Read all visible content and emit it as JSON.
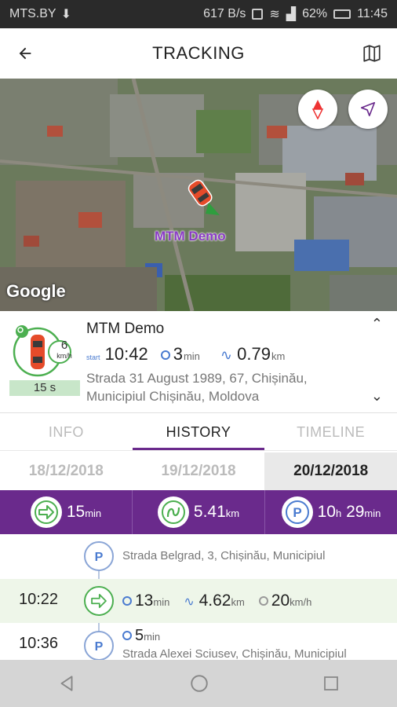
{
  "status": {
    "carrier": "MTS.BY",
    "speed": "617 B/s",
    "battery": "62%",
    "time": "11:45"
  },
  "appbar": {
    "title": "TRACKING"
  },
  "map": {
    "vehicle_label": "MTM Demo",
    "provider": "Google"
  },
  "vehicle": {
    "name": "MTM Demo",
    "speed": "6",
    "speed_unit": "km/h",
    "timer": "15 s",
    "start_tag": "start",
    "start_time": "10:42",
    "duration": "3",
    "duration_unit": "min",
    "distance": "0.79",
    "distance_unit": "km",
    "address_line1": "Strada 31 August 1989, 67, Chișinău,",
    "address_line2": "Municipiul Chișinău, Moldova"
  },
  "tabs": [
    {
      "label": "INFO"
    },
    {
      "label": "HISTORY"
    },
    {
      "label": "TIMELINE"
    }
  ],
  "dates": [
    "18/12/2018",
    "19/12/2018",
    "20/12/2018"
  ],
  "summary": {
    "drive_time": "15",
    "drive_unit": "min",
    "distance": "5.41",
    "distance_unit": "km",
    "park_h": "10",
    "park_h_unit": "h",
    "park_m": "29",
    "park_m_unit": "min"
  },
  "timeline": {
    "row1": {
      "address": "Strada Belgrad, 3, Chișinău, Municipiul"
    },
    "row2": {
      "time": "10:22",
      "duration": "13",
      "duration_unit": "min",
      "distance": "4.62",
      "distance_unit": "km",
      "speed": "20",
      "speed_unit": "km/h"
    },
    "row3": {
      "time": "10:36",
      "duration": "5",
      "duration_unit": "min",
      "address": "Strada Alexei Sciusev, Chișinău, Municipiul"
    }
  },
  "colors": {
    "purple": "#6a2a8c",
    "green": "#4caf50",
    "map_label": "#8a3bc5"
  },
  "icons": [
    "back-arrow-icon",
    "map-icon",
    "compass-icon",
    "navigation-icon",
    "car-icon",
    "drive-icon",
    "route-icon",
    "parking-icon",
    "clock-icon",
    "speed-icon"
  ]
}
